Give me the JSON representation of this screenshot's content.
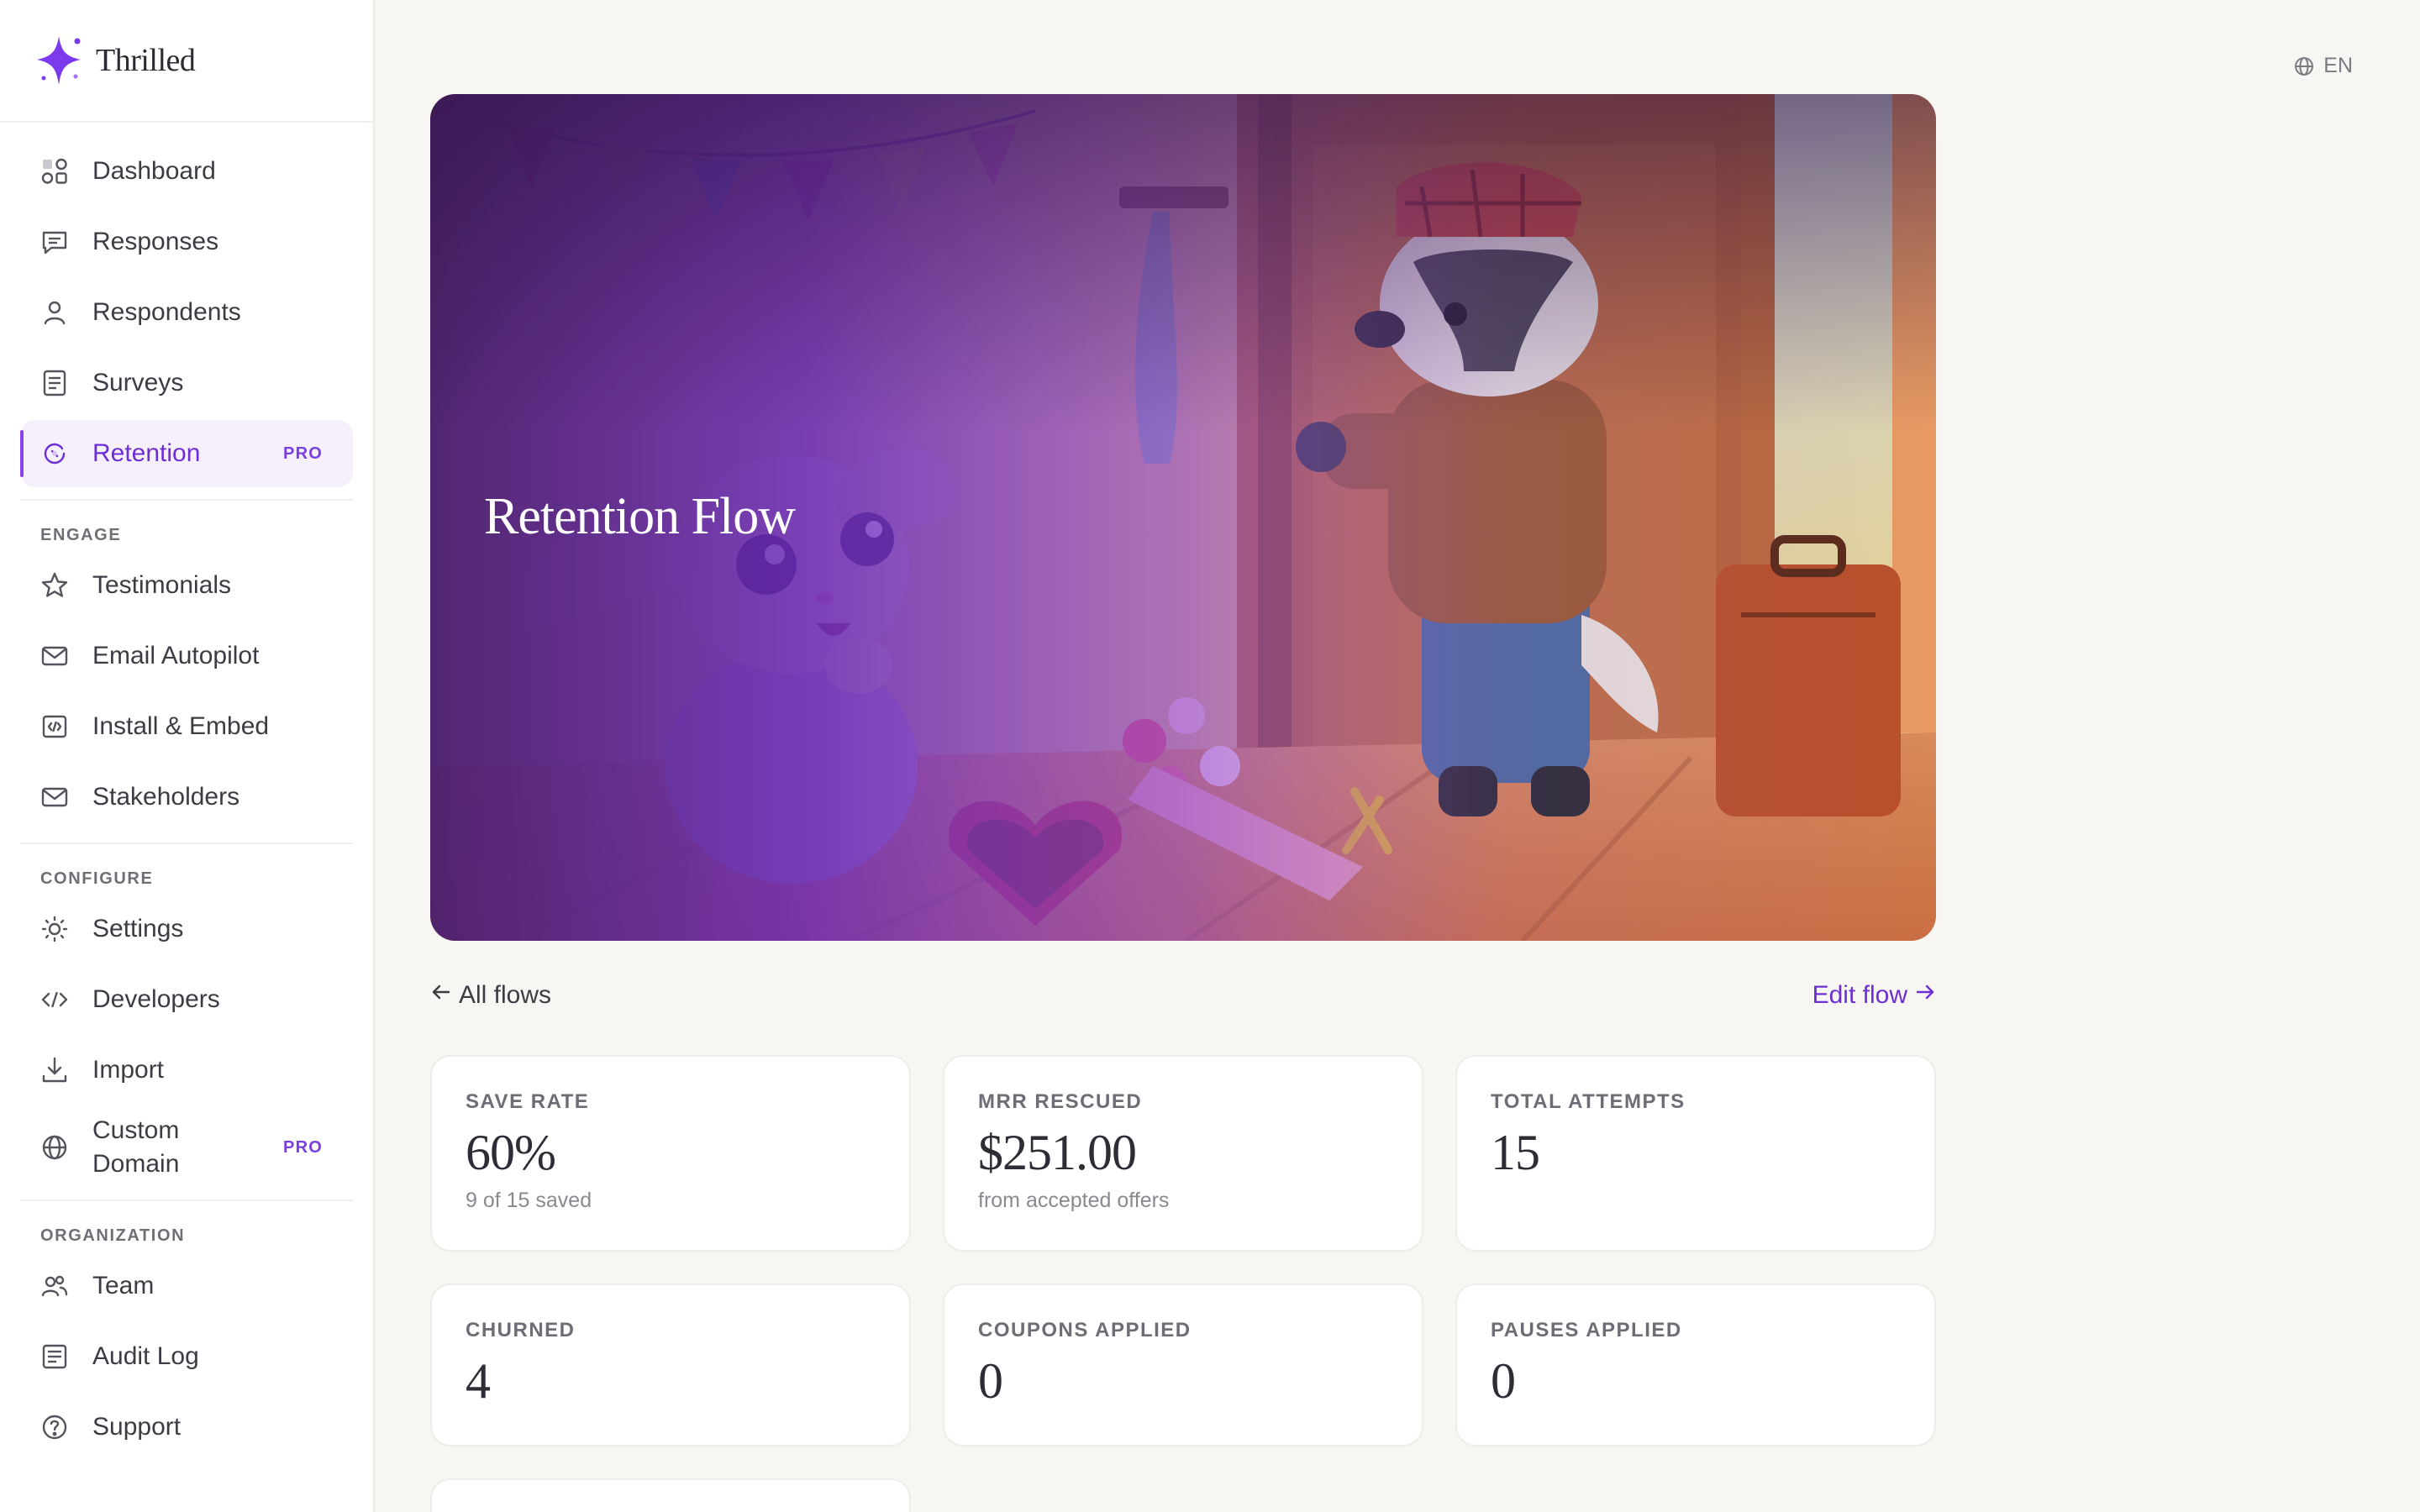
{
  "brand": {
    "name": "Thrilled",
    "accent": "#7c3aed"
  },
  "sidebar": {
    "primary": [
      {
        "label": "Dashboard",
        "icon": "dashboard-icon"
      },
      {
        "label": "Responses",
        "icon": "chat-icon"
      },
      {
        "label": "Respondents",
        "icon": "user-icon"
      },
      {
        "label": "Surveys",
        "icon": "survey-icon"
      },
      {
        "label": "Retention",
        "icon": "retention-icon",
        "badge": "PRO",
        "active": true
      }
    ],
    "engage_title": "ENGAGE",
    "engage": [
      {
        "label": "Testimonials",
        "icon": "star-icon"
      },
      {
        "label": "Email Autopilot",
        "icon": "mail-icon"
      },
      {
        "label": "Install & Embed",
        "icon": "embed-icon"
      },
      {
        "label": "Stakeholders",
        "icon": "mail-icon"
      }
    ],
    "configure_title": "CONFIGURE",
    "configure": [
      {
        "label": "Settings",
        "icon": "sun-icon"
      },
      {
        "label": "Developers",
        "icon": "code-icon"
      },
      {
        "label": "Import",
        "icon": "download-icon"
      },
      {
        "label_line1": "Custom",
        "label_line2": "Domain",
        "icon": "globe-icon",
        "badge": "PRO"
      }
    ],
    "organization_title": "ORGANIZATION",
    "organization": [
      {
        "label": "Team",
        "icon": "team-icon"
      },
      {
        "label": "Audit Log",
        "icon": "log-icon"
      },
      {
        "label": "Support",
        "icon": "help-icon"
      }
    ]
  },
  "language": "EN",
  "hero": {
    "title": "Retention Flow"
  },
  "links": {
    "back": "All flows",
    "edit": "Edit flow"
  },
  "stats": [
    {
      "label": "SAVE RATE",
      "value": "60%",
      "sub": "9 of 15 saved"
    },
    {
      "label": "MRR RESCUED",
      "value": "$251.00",
      "sub": "from accepted offers"
    },
    {
      "label": "TOTAL ATTEMPTS",
      "value": "15",
      "sub": ""
    },
    {
      "label": "CHURNED",
      "value": "4"
    },
    {
      "label": "COUPONS APPLIED",
      "value": "0"
    },
    {
      "label": "PAUSES APPLIED",
      "value": "0"
    }
  ]
}
